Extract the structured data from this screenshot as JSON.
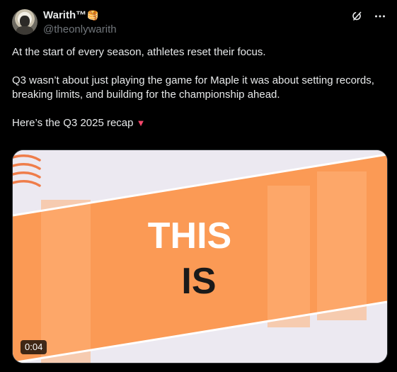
{
  "post": {
    "display_name": "Warith™",
    "name_emoji": "🥞",
    "handle": "@theonlywarith",
    "paragraphs": [
      "At the start of every season, athletes reset their focus.",
      "Q3 wasn’t about just playing the game for Maple it was about setting records, breaking limits, and building for the championship ahead.",
      "Here’s the Q3 2025 recap"
    ],
    "recap_emoji": "▼"
  },
  "icons": {
    "grok": "grok-icon",
    "more": "more-icon",
    "triangle": "red-triangle-icon"
  },
  "video": {
    "headline_line1": "THIS",
    "headline_line2": "IS",
    "duration": "0:04",
    "colors": {
      "orange": "#fb9a55",
      "background": "#ece9f1",
      "dark_text": "#1a1a1a",
      "stripe": "#ffffff",
      "logo": "#ef7d4a"
    }
  },
  "colors": {
    "text": "#e7e9ea",
    "muted": "#71767b",
    "accent_red": "#f4476b"
  }
}
